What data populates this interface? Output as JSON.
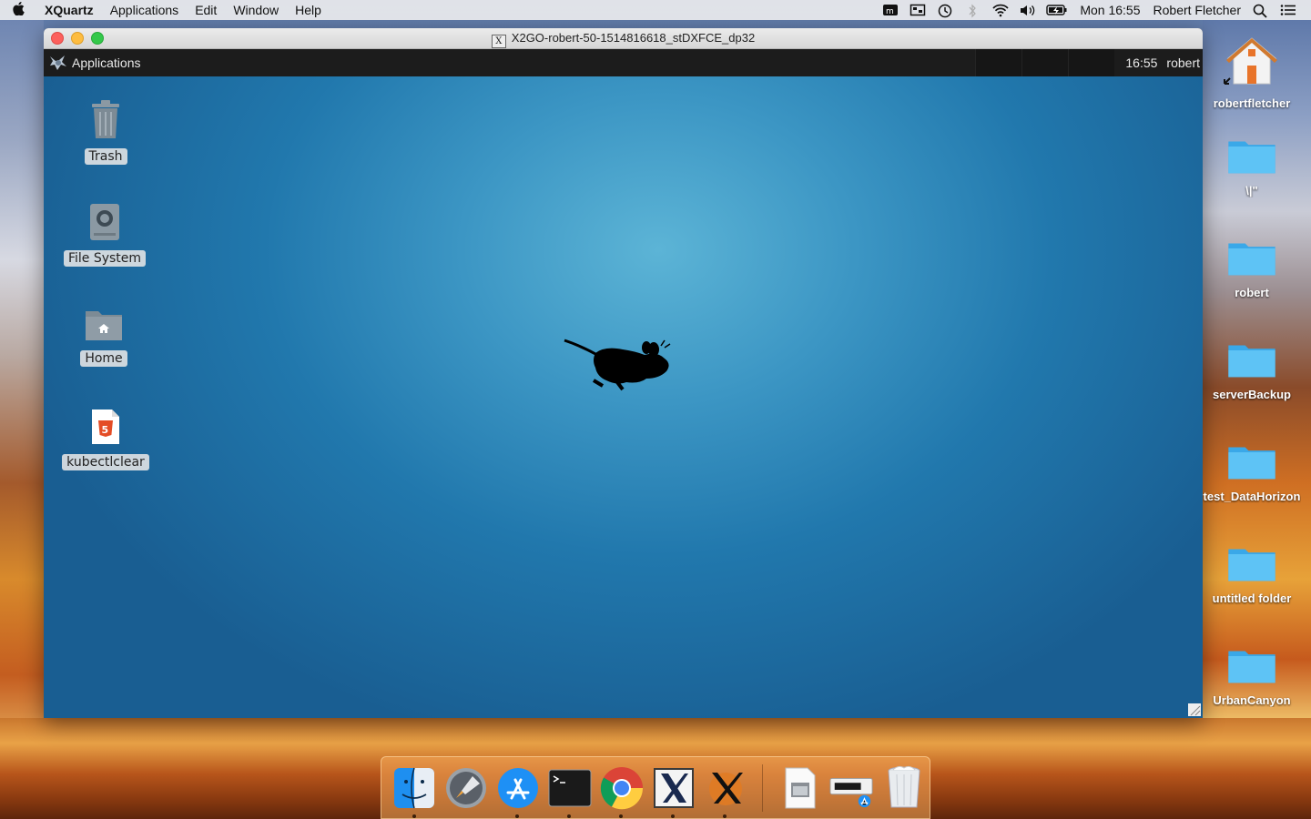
{
  "menubar": {
    "app_name": "XQuartz",
    "menus": [
      "Applications",
      "Edit",
      "Window",
      "Help"
    ],
    "clock": "Mon 16:55",
    "user": "Robert Fletcher"
  },
  "window": {
    "title": "X2GO-robert-50-1514816618_stDXFCE_dp32"
  },
  "panel": {
    "apps_label": "Applications",
    "clock": "16:55",
    "user": "robert"
  },
  "xfce_desktop_icons": [
    {
      "label": "Trash"
    },
    {
      "label": "File System"
    },
    {
      "label": "Home"
    },
    {
      "label": "kubectlclear"
    }
  ],
  "mac_desktop_icons": [
    {
      "label": "robertfletcher"
    },
    {
      "label": "\\|\""
    },
    {
      "label": "robert"
    },
    {
      "label": "serverBackup"
    },
    {
      "label": "test_DataHorizon"
    },
    {
      "label": "untitled folder"
    },
    {
      "label": "UrbanCanyon"
    }
  ],
  "dock": {
    "items": [
      "finder-icon",
      "launchpad-icon",
      "app-store-icon",
      "terminal-icon",
      "chrome-icon",
      "xquartz-icon",
      "x2go-icon",
      "preview-icon",
      "app-store-installer-icon",
      "trash-icon"
    ]
  }
}
